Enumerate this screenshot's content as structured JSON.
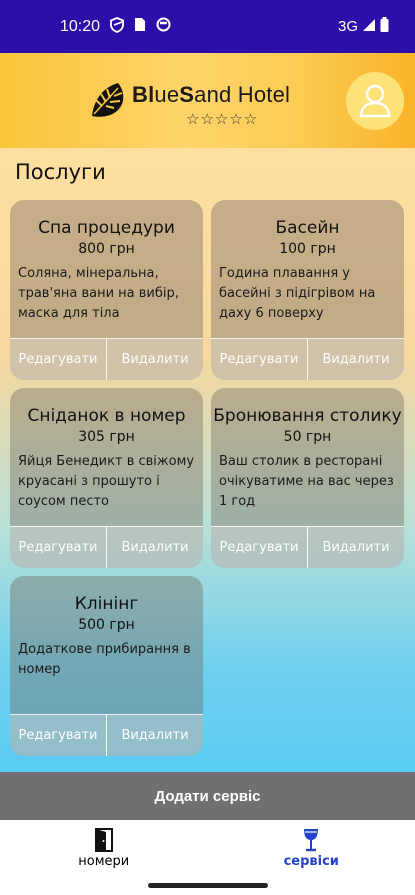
{
  "status_bar": {
    "time": "10:20",
    "network": "3G",
    "icons": [
      "shield-icon",
      "sim-card-icon",
      "circle-status-icon",
      "signal-icon",
      "battery-icon"
    ]
  },
  "header": {
    "brand_bold_1": "Bl",
    "brand_part_2": "ue",
    "brand_bold_3": "S",
    "brand_part_4": "and Hotel",
    "stars": "☆☆☆☆☆"
  },
  "section_title": "Послуги",
  "services": [
    {
      "title": "Спа процедури",
      "price": "800 грн",
      "desc": "Соляна, мінеральна, трав'яна вани на вибір, маска для тіла",
      "edit": "Редагувати",
      "delete": "Видалити"
    },
    {
      "title": "Басейн",
      "price": "100 грн",
      "desc": "Година плавання у басейні з підігрівом на даху 6 поверху",
      "edit": "Редагувати",
      "delete": "Видалити"
    },
    {
      "title": "Сніданок в номер",
      "price": "305 грн",
      "desc": "Яйця Бенедикт в свіжому круасані з прошуто і соусом песто",
      "edit": "Редагувати",
      "delete": "Видалити"
    },
    {
      "title": "Бронювання столику",
      "price": "50 грн",
      "desc": "Ваш столик в ресторані очікуватиме на вас  через 1 год",
      "edit": "Редагувати",
      "delete": "Видалити"
    },
    {
      "title": "Клінінг",
      "price": "500 грн",
      "desc": "Додаткове прибирання в номер",
      "edit": "Редагувати",
      "delete": "Видалити"
    }
  ],
  "add_button": "Додати сервіс",
  "nav": {
    "rooms": "номери",
    "services": "сервіси"
  },
  "colors": {
    "status_bar": "#2c0fa8",
    "active_nav": "#2443c9",
    "add_button": "#707070"
  }
}
